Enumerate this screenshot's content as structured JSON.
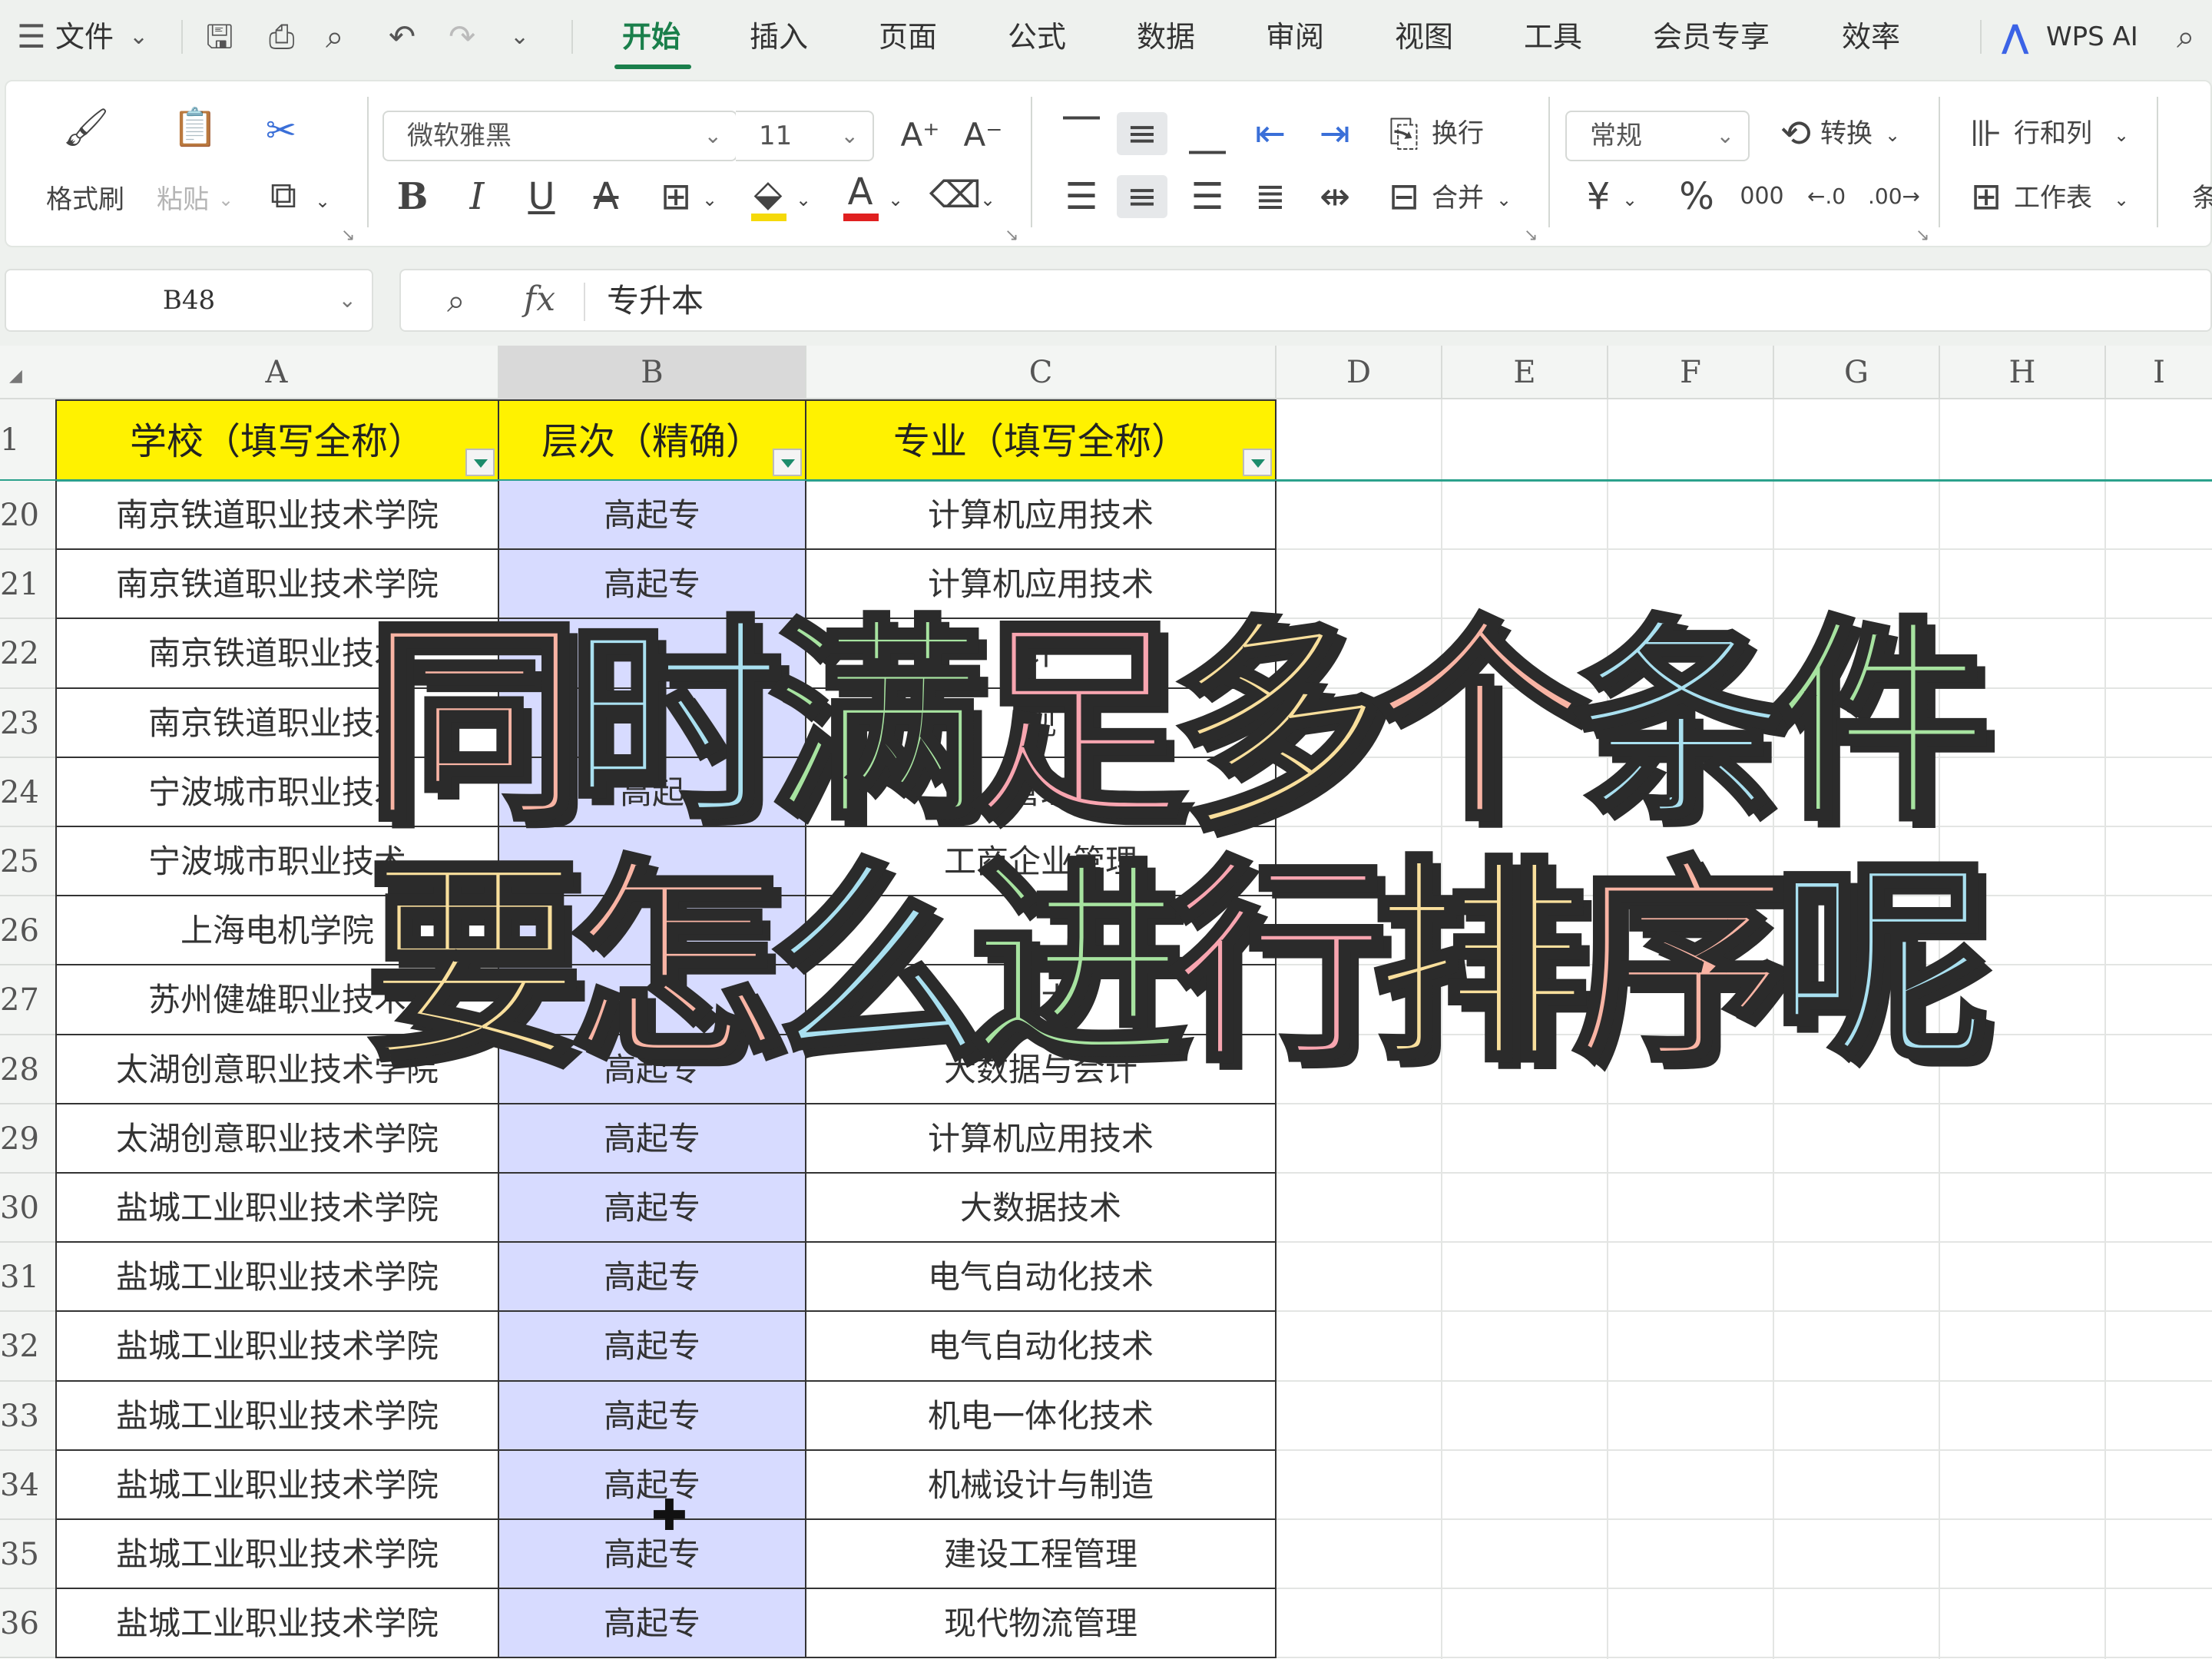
{
  "menubar": {
    "menu_icon": "hamburger-icon",
    "file_label": "文件",
    "tabs": [
      "开始",
      "插入",
      "页面",
      "公式",
      "数据",
      "审阅",
      "视图",
      "工具",
      "会员专享",
      "效率"
    ],
    "active_tab": "开始",
    "wps_ai_label": "WPS AI"
  },
  "ribbon": {
    "format_painter": "格式刷",
    "paste": "粘贴",
    "font_name": "微软雅黑",
    "font_size": "11",
    "wrap": "换行",
    "merge": "合并",
    "number_format": "常规",
    "convert": "转换",
    "rows_cols": "行和列",
    "worksheet": "工作表",
    "bold": "B",
    "italic": "I",
    "underline": "U",
    "percent": "%",
    "currency": "¥",
    "cond": "条",
    "colors": {
      "highlight": "#f5d90a",
      "font": "#e02020"
    }
  },
  "formula_bar": {
    "cell_ref": "B48",
    "fx": "fx",
    "value": "专升本"
  },
  "columns": [
    "A",
    "B",
    "C",
    "D",
    "E",
    "F",
    "G",
    "H",
    "I"
  ],
  "sheet": {
    "header_row_num": "1",
    "headers": [
      "学校（填写全称）",
      "层次（精确）",
      "专业（填写全称）"
    ],
    "rows": [
      {
        "num": "20",
        "a": "南京铁道职业技术学院",
        "b": "高起专",
        "c": "计算机应用技术"
      },
      {
        "num": "21",
        "a": "南京铁道职业技术学院",
        "b": "高起专",
        "c": "计算机应用技术"
      },
      {
        "num": "22",
        "a": "南京铁道职业技术",
        "b": "",
        "c": "计"
      },
      {
        "num": "23",
        "a": "南京铁道职业技术",
        "b": "",
        "c": "现"
      },
      {
        "num": "24",
        "a": "宁波城市职业技术",
        "b": "高起",
        "c": "管理"
      },
      {
        "num": "25",
        "a": "宁波城市职业技术",
        "b": "",
        "c": "工商企业管理"
      },
      {
        "num": "26",
        "a": "上海电机学院",
        "b": "",
        "c": ""
      },
      {
        "num": "27",
        "a": "苏州健雄职业技术",
        "b": "",
        "c": "技术"
      },
      {
        "num": "28",
        "a": "太湖创意职业技术学院",
        "b": "高起专",
        "c": "大数据与会计"
      },
      {
        "num": "29",
        "a": "太湖创意职业技术学院",
        "b": "高起专",
        "c": "计算机应用技术"
      },
      {
        "num": "30",
        "a": "盐城工业职业技术学院",
        "b": "高起专",
        "c": "大数据技术"
      },
      {
        "num": "31",
        "a": "盐城工业职业技术学院",
        "b": "高起专",
        "c": "电气自动化技术"
      },
      {
        "num": "32",
        "a": "盐城工业职业技术学院",
        "b": "高起专",
        "c": "电气自动化技术"
      },
      {
        "num": "33",
        "a": "盐城工业职业技术学院",
        "b": "高起专",
        "c": "机电一体化技术"
      },
      {
        "num": "34",
        "a": "盐城工业职业技术学院",
        "b": "高起专",
        "c": "机械设计与制造"
      },
      {
        "num": "35",
        "a": "盐城工业职业技术学院",
        "b": "高起专",
        "c": "建设工程管理"
      },
      {
        "num": "36",
        "a": "盐城工业职业技术学院",
        "b": "高起专",
        "c": "现代物流管理"
      }
    ]
  },
  "overlay": {
    "line1": "同时满足多个条件",
    "line2": "要怎么进行排序呢",
    "palette": [
      "#f9b4a4",
      "#a9e0f0",
      "#a7e3a0",
      "#f8a5b0",
      "#f9df9c"
    ]
  }
}
